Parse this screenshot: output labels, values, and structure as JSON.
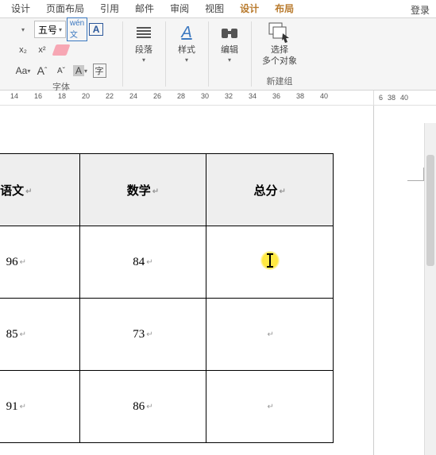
{
  "login": "登录",
  "tabs": {
    "start": "设计",
    "layout": "页面布局",
    "refs": "引用",
    "mail": "邮件",
    "review": "审阅",
    "view": "视图",
    "ctx_design": "设计",
    "ctx_layout": "布局"
  },
  "font_group": {
    "size_label": "五号",
    "group_label": "字体",
    "sub_x2": "x₂",
    "sup_x2": "x²",
    "text_Aa": "Aa",
    "grow_A": "A",
    "shrink_A": "A",
    "highlight_A": "A",
    "char_border": "字"
  },
  "paragraph_group": {
    "label": "段落"
  },
  "styles_group": {
    "label": "样式",
    "icon_letter": "A"
  },
  "edit_group": {
    "label": "编辑"
  },
  "select_group": {
    "select": "选择",
    "multi": "多个对象",
    "newgroup": "新建组"
  },
  "ruler": {
    "left": [
      "14",
      "16",
      "18",
      "20",
      "22",
      "24",
      "26",
      "28",
      "30",
      "32",
      "34",
      "36",
      "38",
      "40"
    ],
    "right": [
      "6",
      "38",
      "40"
    ]
  },
  "chart_data": {
    "type": "table",
    "headers": [
      "语文",
      "数学",
      "总分"
    ],
    "rows": [
      {
        "语文": 96,
        "数学": 84,
        "总分": ""
      },
      {
        "语文": 85,
        "数学": 73,
        "总分": ""
      },
      {
        "语文": 91,
        "数学": 86,
        "总分": ""
      }
    ]
  }
}
